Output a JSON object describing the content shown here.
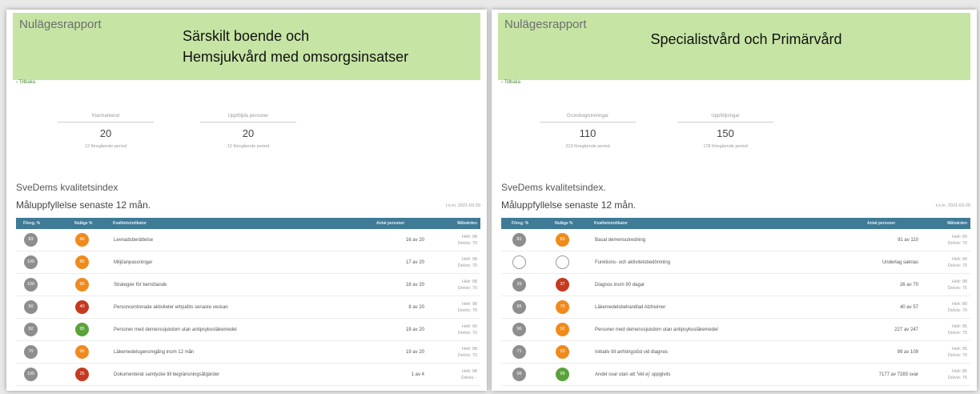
{
  "colors": {
    "banner": "#c6e5a5",
    "table_header": "#3f7a96",
    "grey_circle": "#8e8e8e",
    "orange": "#f08a1c",
    "red": "#c53a1f",
    "green": "#5aa23a"
  },
  "left": {
    "report_title": "Nulägesrapport",
    "banner_line1": "Särskilt boende och",
    "banner_line2": "Hemsjukvård med omsorgsinsatser",
    "back": "‹ Tillbaka",
    "stats": [
      {
        "label": "Klarmarkerat",
        "value": "20",
        "prev": "12 föregående period"
      },
      {
        "label": "Uppföljda personer",
        "value": "20",
        "prev": "12 föregående period"
      }
    ],
    "index_title": "SveDems kvalitetsindex",
    "measure_title": "Måluppfyllelse senaste 12 mån.",
    "date": "t.o.m. 2021-03-29",
    "headers": {
      "prev": "Föreg. %",
      "now": "Nuläge %",
      "ind": "Kvalitetsindikator",
      "ant": "Antal personer",
      "mv": "Målvärden"
    },
    "rows": [
      {
        "prev": "83",
        "now": "80",
        "now_color": "orange",
        "ind": "Levnadsberättelse",
        "ant": "16 av 20",
        "mv1": "Helt: 98",
        "mv2": "Delvis: 70"
      },
      {
        "prev": "100",
        "now": "85",
        "now_color": "orange",
        "ind": "Miljöanpassningar",
        "ant": "17 av 20",
        "mv1": "Helt: 98",
        "mv2": "Delvis: 70"
      },
      {
        "prev": "100",
        "now": "90",
        "now_color": "orange",
        "ind": "Strategier för bemötande",
        "ant": "18 av 20",
        "mv1": "Helt: 98",
        "mv2": "Delvis: 70"
      },
      {
        "prev": "50",
        "now": "40",
        "now_color": "red",
        "ind": "Personcentrerade aktiviteter erbjudits senaste veckan",
        "ant": "8 av 20",
        "mv1": "Helt: 98",
        "mv2": "Delvis: 70"
      },
      {
        "prev": "92",
        "now": "95",
        "now_color": "green",
        "ind": "Personer med demenssjukdom utan antipsykosläkemedel",
        "ant": "19 av 20",
        "mv1": "Helt: 90",
        "mv2": "Delvis: 70"
      },
      {
        "prev": "70",
        "now": "95",
        "now_color": "orange",
        "ind": "Läkemedelsgenomgång inom 12 mån",
        "ant": "19 av 20",
        "mv1": "Helt: 98",
        "mv2": "Delvis: 70"
      },
      {
        "prev": "100",
        "now": "25",
        "now_color": "red",
        "ind": "Dokumenterat samtycke till begränsningsåtgärder",
        "ant": "1 av 4",
        "mv1": "Helt: 98",
        "mv2": "Delvis: -"
      }
    ]
  },
  "right": {
    "report_title": "Nulägesrapport",
    "banner_line1": "Specialistvård och Primärvård",
    "back": "‹ Tillbaka",
    "stats": [
      {
        "label": "Grundregistreringar",
        "value": "110",
        "prev": "213 föregående period"
      },
      {
        "label": "Uppföljningar",
        "value": "150",
        "prev": "178 föregående period"
      }
    ],
    "index_title": "SveDems kvalitetsindex.",
    "measure_title": "Måluppfyllelse senaste 12 mån.",
    "date": "t.o.m. 2021-03-29",
    "headers": {
      "prev": "Föreg. %",
      "now": "Nuläge %",
      "ind": "Kvalitetsindikator",
      "ant": "Antal personer",
      "mv": "Målvärden"
    },
    "rows": [
      {
        "prev": "81",
        "now": "83",
        "now_color": "orange",
        "ind": "Basal demensutredning",
        "ant": "91 av 110",
        "mv1": "Helt: 90",
        "mv2": "Delvis: 70"
      },
      {
        "prev": "",
        "now": "",
        "now_color": "empty",
        "ind": "Funktions- och aktivitetsbedömning",
        "ant": "Underlag saknas",
        "mv1": "Helt: 90",
        "mv2": "Delvis: 70"
      },
      {
        "prev": "29",
        "now": "37",
        "now_color": "red",
        "ind": "Diagnos inom 90 dagar",
        "ant": "26 av 70",
        "mv1": "Helt: 98",
        "mv2": "Delvis: 75"
      },
      {
        "prev": "65",
        "now": "70",
        "now_color": "orange",
        "ind": "Läkemedelsbehandlad Alzheimer",
        "ant": "40 av 57",
        "mv1": "Helt: 80",
        "mv2": "Delvis: 70"
      },
      {
        "prev": "96",
        "now": "92",
        "now_color": "orange",
        "ind": "Personer med demenssjukdom utan antipsykosläkemedel",
        "ant": "227 av 247",
        "mv1": "Helt: 95",
        "mv2": "Delvis: 75"
      },
      {
        "prev": "71",
        "now": "93",
        "now_color": "orange",
        "ind": "Initiativ till anhörigstöd vid diagnos",
        "ant": "99 av 109",
        "mv1": "Helt: 95",
        "mv2": "Delvis: 70"
      },
      {
        "prev": "98",
        "now": "99",
        "now_color": "green",
        "ind": "Andel svar utan att 'Vet ej' uppgivits",
        "ant": "7177 av 7283 svar",
        "mv1": "Helt: 85",
        "mv2": "Delvis: 75"
      }
    ]
  }
}
